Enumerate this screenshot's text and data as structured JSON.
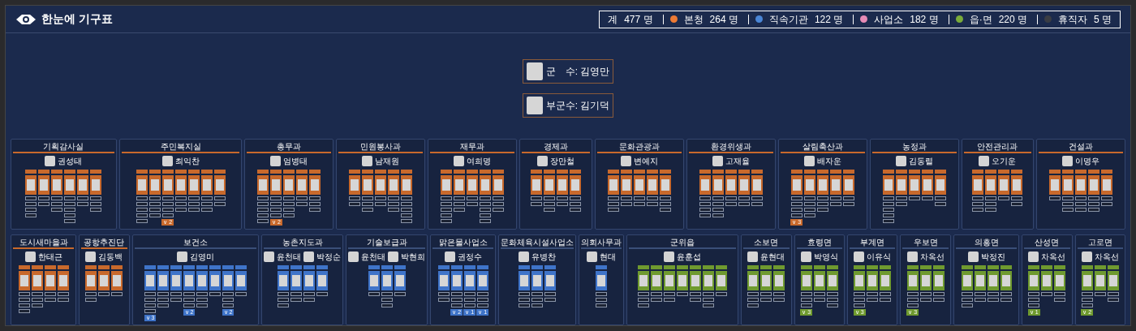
{
  "title": "한눈에 기구표",
  "summary": [
    {
      "label": "계",
      "value": "477 명"
    },
    {
      "label": "본청",
      "value": "264 명",
      "color": "#ee7a34"
    },
    {
      "label": "직속기관",
      "value": "122 명",
      "color": "#4a86d6"
    },
    {
      "label": "사업소",
      "value": "182 명",
      "color": "#e78bb6"
    },
    {
      "label": "읍·면",
      "value": "220 명",
      "color": "#7aab3a"
    },
    {
      "label": "휴직자",
      "value": "5 명",
      "color": "#3a3d44"
    }
  ],
  "leaders": [
    {
      "title": "군　수: 김영만"
    },
    {
      "title": "부군수: 김기덕"
    }
  ],
  "rows": [
    {
      "departments": [
        {
          "name": "기획감사실",
          "kind": "hq",
          "heads": [
            "권성태"
          ],
          "teams": [
            {
              "kind": "four"
            },
            {
              "kind": "two"
            },
            {
              "kind": "three"
            },
            {
              "kind": "five"
            },
            {
              "kind": "two"
            },
            {
              "kind": "three"
            }
          ]
        },
        {
          "name": "주민복지실",
          "kind": "hq",
          "heads": [
            "최익찬"
          ],
          "teams": [
            {
              "kind": "five"
            },
            {
              "kind": "four"
            },
            {
              "kind": "four",
              "badge": "∨ 2"
            },
            {
              "kind": "three"
            },
            {
              "kind": "three"
            },
            {
              "kind": "three"
            },
            {
              "kind": "two"
            }
          ]
        },
        {
          "name": "총무과",
          "kind": "hq",
          "heads": [
            "엄병태"
          ],
          "teams": [
            {
              "kind": "five"
            },
            {
              "kind": "four",
              "badge": "∨ 2"
            },
            {
              "kind": "four"
            },
            {
              "kind": "two"
            },
            {
              "kind": "three"
            }
          ]
        },
        {
          "name": "민원봉사과",
          "kind": "hq",
          "heads": [
            "남재원"
          ],
          "teams": [
            {
              "kind": "two"
            },
            {
              "kind": "three"
            },
            {
              "kind": "two"
            },
            {
              "kind": "three"
            },
            {
              "kind": "five"
            }
          ]
        },
        {
          "name": "재무과",
          "kind": "hq",
          "heads": [
            "여희명"
          ],
          "teams": [
            {
              "kind": "five"
            },
            {
              "kind": "three"
            },
            {
              "kind": "two"
            },
            {
              "kind": "five"
            },
            {
              "kind": "three"
            }
          ]
        },
        {
          "name": "경제과",
          "kind": "hq",
          "heads": [
            "장만철"
          ],
          "teams": [
            {
              "kind": "two"
            },
            {
              "kind": "three"
            },
            {
              "kind": "two"
            },
            {
              "kind": "three"
            }
          ]
        },
        {
          "name": "문화관광과",
          "kind": "hq",
          "heads": [
            "변예지"
          ],
          "teams": [
            {
              "kind": "three"
            },
            {
              "kind": "two"
            },
            {
              "kind": "two"
            },
            {
              "kind": "two"
            },
            {
              "kind": "three"
            }
          ]
        },
        {
          "name": "환경위생과",
          "kind": "hq",
          "heads": [
            "고재율"
          ],
          "teams": [
            {
              "kind": "four"
            },
            {
              "kind": "four"
            },
            {
              "kind": "two"
            },
            {
              "kind": "two"
            },
            {
              "kind": "two"
            }
          ]
        },
        {
          "name": "살림축산과",
          "kind": "hq",
          "heads": [
            "배자운"
          ],
          "teams": [
            {
              "kind": "four",
              "badge": "∨ 3"
            },
            {
              "kind": "four"
            },
            {
              "kind": "three"
            },
            {
              "kind": "two"
            },
            {
              "kind": "two"
            }
          ]
        },
        {
          "name": "농정과",
          "kind": "hq",
          "heads": [
            "김동렬"
          ],
          "teams": [
            {
              "kind": "five"
            },
            {
              "kind": "two"
            },
            {
              "kind": "one"
            },
            {
              "kind": "one"
            },
            {
              "kind": "two"
            }
          ]
        },
        {
          "name": "안전관리과",
          "kind": "hq",
          "heads": [
            "오기운"
          ],
          "teams": [
            {
              "kind": "three"
            },
            {
              "kind": "three"
            },
            {
              "kind": "one"
            },
            {
              "kind": "two"
            }
          ]
        },
        {
          "name": "건설과",
          "kind": "hq",
          "heads": [
            "이명우"
          ],
          "teams": [
            {
              "kind": "one"
            },
            {
              "kind": "three"
            },
            {
              "kind": "three"
            },
            {
              "kind": "three"
            },
            {
              "kind": "two"
            }
          ]
        }
      ]
    },
    {
      "departments": [
        {
          "name": "도시새마을과",
          "kind": "hq",
          "heads": [
            "한태근"
          ],
          "teams": [
            {
              "kind": "four"
            },
            {
              "kind": "three"
            },
            {
              "kind": "two"
            },
            {
              "kind": "two"
            }
          ]
        },
        {
          "name": "공항추진단",
          "kind": "hq",
          "heads": [
            "김동백"
          ],
          "teams": [
            {
              "kind": "two"
            },
            {
              "kind": "one"
            },
            {
              "kind": "one"
            }
          ]
        },
        {
          "name": "보건소",
          "kind": "agency",
          "heads": [
            "김영미"
          ],
          "teams": [
            {
              "kind": "four",
              "badge": "∨ 3"
            },
            {
              "kind": "three"
            },
            {
              "kind": "two"
            },
            {
              "kind": "three",
              "badge": "∨ 2"
            },
            {
              "kind": "three"
            },
            {
              "kind": "one"
            },
            {
              "kind": "three",
              "badge": "∨ 2"
            },
            {
              "kind": "one"
            }
          ]
        },
        {
          "name": "농촌지도과",
          "kind": "agency",
          "heads": [
            "윤천태",
            "박정순"
          ],
          "teams": [
            {
              "kind": "three"
            },
            {
              "kind": "two"
            },
            {
              "kind": "two"
            },
            {
              "kind": "one"
            }
          ]
        },
        {
          "name": "기술보급과",
          "kind": "agency",
          "heads": [
            "윤천태",
            "박현희"
          ],
          "teams": [
            {
              "kind": "one"
            },
            {
              "kind": "three"
            },
            {
              "kind": "one"
            }
          ]
        },
        {
          "name": "맑은물사업소",
          "kind": "agency",
          "heads": [
            "권정수"
          ],
          "teams": [
            {
              "kind": "two"
            },
            {
              "kind": "three",
              "badge": "∨ 2"
            },
            {
              "kind": "three",
              "badge": "∨ 1"
            },
            {
              "kind": "three",
              "badge": "∨ 1"
            }
          ]
        },
        {
          "name": "문화체육시설사업소",
          "kind": "agency",
          "heads": [
            "유병찬"
          ],
          "teams": [
            {
              "kind": "three"
            },
            {
              "kind": "three"
            },
            {
              "kind": "two"
            }
          ]
        },
        {
          "name": "의회사무과",
          "kind": "agency",
          "heads": [
            "현대"
          ],
          "teams": [
            {
              "kind": "three"
            }
          ]
        },
        {
          "name": "군위읍",
          "kind": "town",
          "heads": [
            "윤훈섭"
          ],
          "teams": [
            {
              "kind": "three"
            },
            {
              "kind": "two"
            },
            {
              "kind": "two"
            },
            {
              "kind": "one"
            },
            {
              "kind": "two"
            },
            {
              "kind": "three"
            },
            {
              "kind": "one"
            }
          ]
        },
        {
          "name": "소보면",
          "kind": "town",
          "heads": [
            "윤현대"
          ],
          "teams": [
            {
              "kind": "three"
            },
            {
              "kind": "two"
            },
            {
              "kind": "two"
            }
          ]
        },
        {
          "name": "효령면",
          "kind": "town",
          "heads": [
            "박영식"
          ],
          "teams": [
            {
              "kind": "three",
              "badge": "∨ 3"
            },
            {
              "kind": "two"
            },
            {
              "kind": "three"
            }
          ]
        },
        {
          "name": "부계면",
          "kind": "town",
          "heads": [
            "이유식"
          ],
          "teams": [
            {
              "kind": "three",
              "badge": "∨ 3"
            },
            {
              "kind": "two"
            },
            {
              "kind": "two"
            }
          ]
        },
        {
          "name": "우보면",
          "kind": "town",
          "heads": [
            "차옥선"
          ],
          "teams": [
            {
              "kind": "three",
              "badge": "∨ 3"
            },
            {
              "kind": "two"
            },
            {
              "kind": "two"
            }
          ]
        },
        {
          "name": "의흥면",
          "kind": "town",
          "heads": [
            "박정진"
          ],
          "teams": [
            {
              "kind": "three"
            },
            {
              "kind": "two"
            },
            {
              "kind": "two"
            },
            {
              "kind": "two"
            }
          ]
        },
        {
          "name": "산성면",
          "kind": "town",
          "heads": [
            "차옥선"
          ],
          "teams": [
            {
              "kind": "three",
              "badge": "∨ 1"
            },
            {
              "kind": "one"
            },
            {
              "kind": "two"
            }
          ]
        },
        {
          "name": "고로면",
          "kind": "town",
          "heads": [
            "차옥선"
          ],
          "teams": [
            {
              "kind": "three",
              "badge": "∨ 2"
            },
            {
              "kind": "one"
            },
            {
              "kind": "two"
            }
          ]
        }
      ]
    }
  ]
}
